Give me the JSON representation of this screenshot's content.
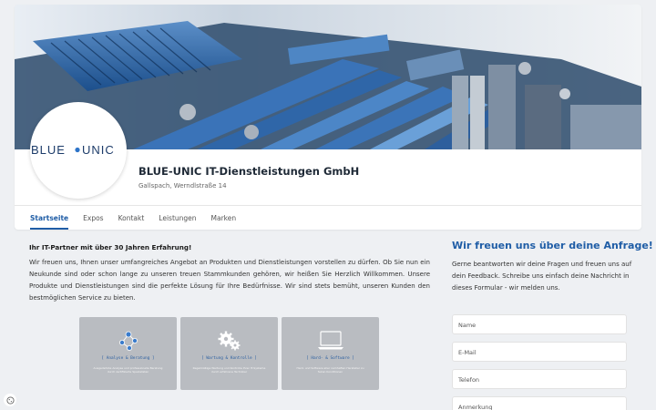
{
  "profile": {
    "company_name": "BLUE-UNIC IT-Dienstleistungen GmbH",
    "address": "Gallspach, Werndlstraße 14",
    "logo_text_left": "BLUE",
    "logo_text_right": "UNIC"
  },
  "tabs": [
    {
      "label": "Startseite",
      "active": true
    },
    {
      "label": "Expos"
    },
    {
      "label": "Kontakt"
    },
    {
      "label": "Leistungen"
    },
    {
      "label": "Marken"
    }
  ],
  "intro": {
    "heading": "Ihr IT-Partner mit über 30 Jahren Erfahrung!",
    "text": "Wir freuen uns, Ihnen unser umfangreiches Angebot an Produkten und Dienstleistungen vorstellen zu dürfen. Ob Sie nun ein Neukunde sind oder schon lange zu unseren treuen Stammkunden gehören, wir heißen Sie Herzlich Willkommen. Unsere Produkte und Dienstleistungen sind die perfekte Lösung für Ihre Bedürfnisse. Wir sind stets bemüht, unseren Kunden den bestmöglichen Service zu bieten."
  },
  "services": [
    {
      "title": "[ Analyse & Beratung ]",
      "icon": "network-icon",
      "desc": "Ausgedehnte Analyse und professionelle Beratung durch zertifizierte Spezialisten"
    },
    {
      "title": "[ Wartung & Kontrolle ]",
      "icon": "gears-icon",
      "desc": "Regelmäßige Wartung und Kontrolle Ihrer IT-Systeme durch erfahrene Techniker"
    },
    {
      "title": "[ Hard- & Software ]",
      "icon": "laptop-icon",
      "desc": "Hard- und Software aller namhaften Hersteller zu fairen Konditionen"
    }
  ],
  "form": {
    "heading": "Wir freuen uns über deine Anfrage!",
    "text": "Gerne beantworten wir deine Fragen und freuen uns auf dein Feedback. Schreibe uns einfach deine Nachricht in dieses Formular - wir melden uns.",
    "fields": [
      "Name",
      "E-Mail",
      "Telefon",
      "Anmerkung"
    ]
  },
  "colors": {
    "accent": "#1f5da6",
    "service_tile": "#b9bcc1",
    "background": "#eef0f3"
  }
}
